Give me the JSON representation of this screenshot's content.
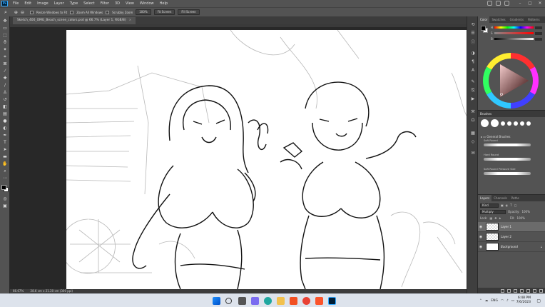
{
  "app": {
    "logo": "Ps",
    "menu": [
      "File",
      "Edit",
      "Image",
      "Layer",
      "Type",
      "Select",
      "Filter",
      "3D",
      "View",
      "Window",
      "Help"
    ]
  },
  "options_bar": {
    "resize_windows_label": "Resize Windows to Fit",
    "zoom_all_windows_label": "Zoom All Windows",
    "scrubby_zoom_label": "Scrubby Zoom",
    "zoom_pct_label": "100%",
    "fit_screen_label": "Fit Screen",
    "fill_screen_label": "Fill Screen"
  },
  "document": {
    "tab_title": "Sketch_400_OMG_Beach_scene_colors.psd @ 66.7% (Layer 1, RGB/8)",
    "close_glyph": "×"
  },
  "status_bar": {
    "zoom": "66.67%",
    "doc_size": "28.6 cm x 21.20 cm (300 ppi)"
  },
  "color_panel": {
    "tabs": [
      "Color",
      "Swatches",
      "Gradients",
      "Patterns"
    ],
    "slider_labels": [
      "H",
      "S",
      "B"
    ],
    "foreground": "#000000",
    "background": "#ffffff"
  },
  "brushes_panel": {
    "title": "Brushes",
    "group": "General Brushes",
    "items": [
      "Soft Round",
      "Hard Round",
      "Soft Round Pressure Size"
    ]
  },
  "layers_panel": {
    "tabs": [
      "Layers",
      "Channels",
      "Paths"
    ],
    "kind_label": "Kind",
    "blend_mode": "Multiply",
    "opacity_label": "Opacity:",
    "opacity_value": "100%",
    "lock_label": "Lock:",
    "fill_label": "Fill:",
    "fill_value": "100%",
    "layers": [
      {
        "name": "Layer 1",
        "selected": true
      },
      {
        "name": "Layer 2",
        "selected": false
      },
      {
        "name": "Background",
        "selected": false
      }
    ]
  },
  "taskbar": {
    "language": "ENG",
    "time": "6:48 PM",
    "date": "7/6/2023"
  }
}
